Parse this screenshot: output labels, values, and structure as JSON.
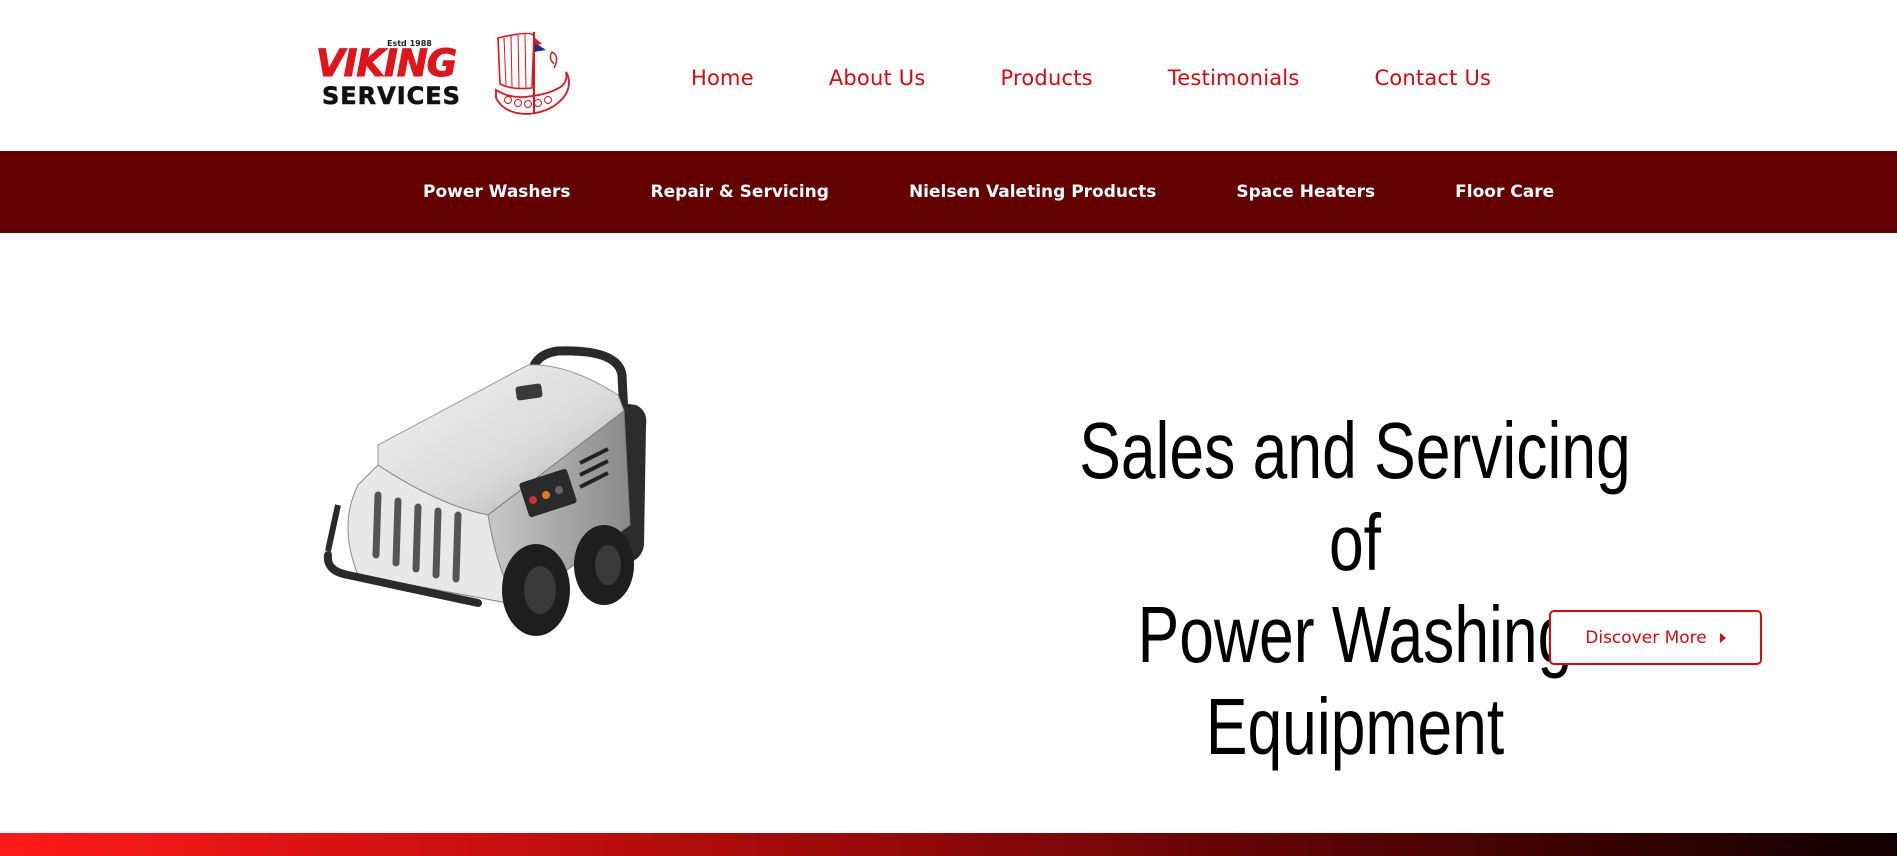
{
  "brand": {
    "estd": "Estd 1988",
    "line1": "VIKING",
    "line2": "SERVICES",
    "logo_icon": "viking-ship-icon",
    "accent_color": "#e0141b"
  },
  "main_nav": {
    "items": [
      {
        "label": "Home"
      },
      {
        "label": "About Us"
      },
      {
        "label": "Products"
      },
      {
        "label": "Testimonials"
      },
      {
        "label": "Contact Us"
      }
    ],
    "color": "#d8080e"
  },
  "sub_nav": {
    "background": "#620002",
    "items": [
      {
        "label": "Power Washers"
      },
      {
        "label": "Repair & Servicing"
      },
      {
        "label": "Nielsen Valeting Products"
      },
      {
        "label": "Space Heaters"
      },
      {
        "label": "Floor Care"
      }
    ]
  },
  "hero": {
    "image": "power-washer-machine",
    "title_line1": "Sales and Servicing of",
    "title_line2": "Power Washing Equipment",
    "cta_label": "Discover More",
    "cta_icon": "caret-right-icon"
  }
}
